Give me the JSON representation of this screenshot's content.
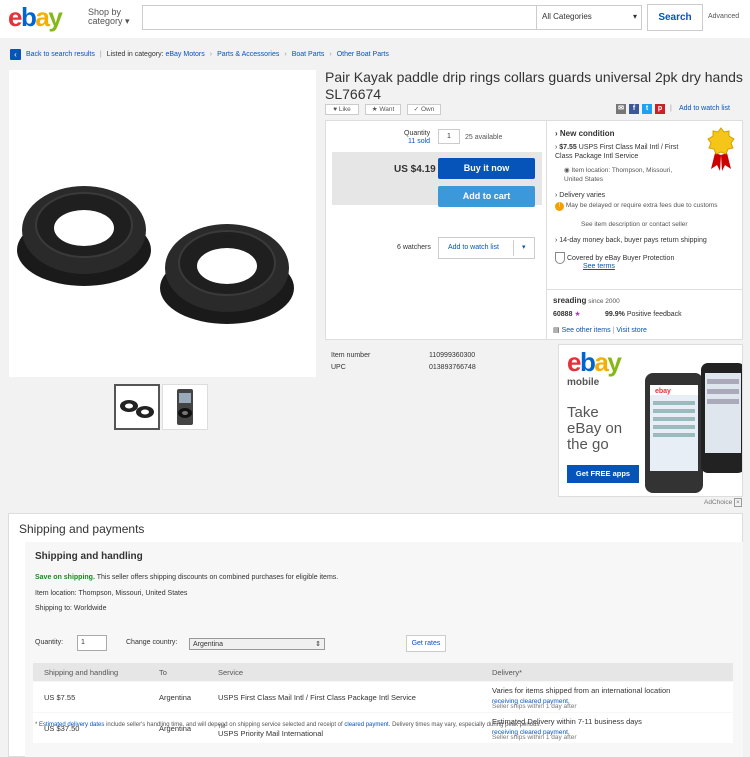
{
  "header": {
    "logo": [
      "e",
      "b",
      "a",
      "y"
    ],
    "shop_by_line1": "Shop by",
    "shop_by_line2": "category",
    "category_select": "All Categories",
    "search_label": "Search",
    "advanced_label": "Advanced"
  },
  "breadcrumb": {
    "back": "Back to search results",
    "listed_in": "Listed in category:",
    "items": [
      "eBay Motors",
      "Parts & Accessories",
      "Boat Parts",
      "Other Boat Parts"
    ]
  },
  "listing": {
    "title": "Pair Kayak paddle drip rings collars guards universal 2pk dry hands SL76674",
    "like": "Like",
    "want": "Want",
    "own": "Own",
    "add_to_watch_list_top": "Add to watch list"
  },
  "buybox": {
    "quantity_label": "Quantity",
    "sold": "11 sold",
    "quantity_value": "1",
    "available": "25 available",
    "price": "US $4.19",
    "buy_now": "Buy it now",
    "add_to_cart": "Add to cart",
    "watchers": "6 watchers",
    "add_to_watch_list": "Add to watch list"
  },
  "details": {
    "condition": "New condition",
    "shipping_price": "$7.55",
    "shipping_service": "USPS First Class Mail Intl / First Class Package Intl Service",
    "item_location": "Item location: Thompson, Missouri, United States",
    "delivery_title": "Delivery varies",
    "delivery_note": "May be delayed or require extra fees due to customs",
    "delivery_see": "See item description or contact seller",
    "returns": "14-day money back, buyer pays return shipping",
    "protection": "Covered by eBay Buyer Protection",
    "see_terms": "See terms",
    "seller_name": "sreading",
    "seller_since": "since 2000",
    "feedback_score": "60888",
    "positive": "99.9%",
    "positive_label": "Positive feedback",
    "see_other": "See other items",
    "visit_store": "Visit store"
  },
  "specifics": {
    "item_number_label": "Item number",
    "item_number": "110999360300",
    "upc_label": "UPC",
    "upc": "013893766748"
  },
  "ad": {
    "brand": "ebay",
    "mobile": "mobile",
    "line1": "Take",
    "line2": "eBay on",
    "line3": "the go",
    "cta": "Get FREE apps",
    "adchoice": "AdChoice"
  },
  "shipping": {
    "title": "Shipping and payments",
    "subtitle": "Shipping and handling",
    "save_label": "Save on shipping.",
    "save_text": "This seller offers shipping discounts on combined purchases for eligible items.",
    "location": "Item location: Thompson, Missouri, United States",
    "ships_to": "Shipping to: Worldwide",
    "quantity_label": "Quantity:",
    "quantity_value": "1",
    "country_label": "Change country:",
    "country_value": "Argentina",
    "get_rates": "Get rates",
    "headers": [
      "Shipping and handling",
      "To",
      "Service",
      "Delivery*"
    ],
    "rows": [
      {
        "price": "US $7.55",
        "to": "Argentina",
        "service": "USPS First Class Mail Intl / First Class Package Intl Service",
        "delivery": "Varies for items shipped from an international location",
        "note": "Seller ships within 1 day after",
        "note_link": "receiving cleared payment."
      },
      {
        "price": "US $37.50",
        "to": "Argentina",
        "service": "USPS Priority Mail International",
        "tm": "TM",
        "delivery": "Estimated Delivery within 7-11 business days",
        "note": "Seller ships within 1 day after",
        "note_link": "receiving cleared payment."
      }
    ],
    "footnote_star": "*",
    "footnote_link1": "Estimated delivery dates",
    "footnote_mid": "include seller's handling time, and will depend on shipping service selected and receipt of",
    "footnote_link2": "cleared payment.",
    "footnote_end": "Delivery times may vary, especially during peak periods."
  }
}
